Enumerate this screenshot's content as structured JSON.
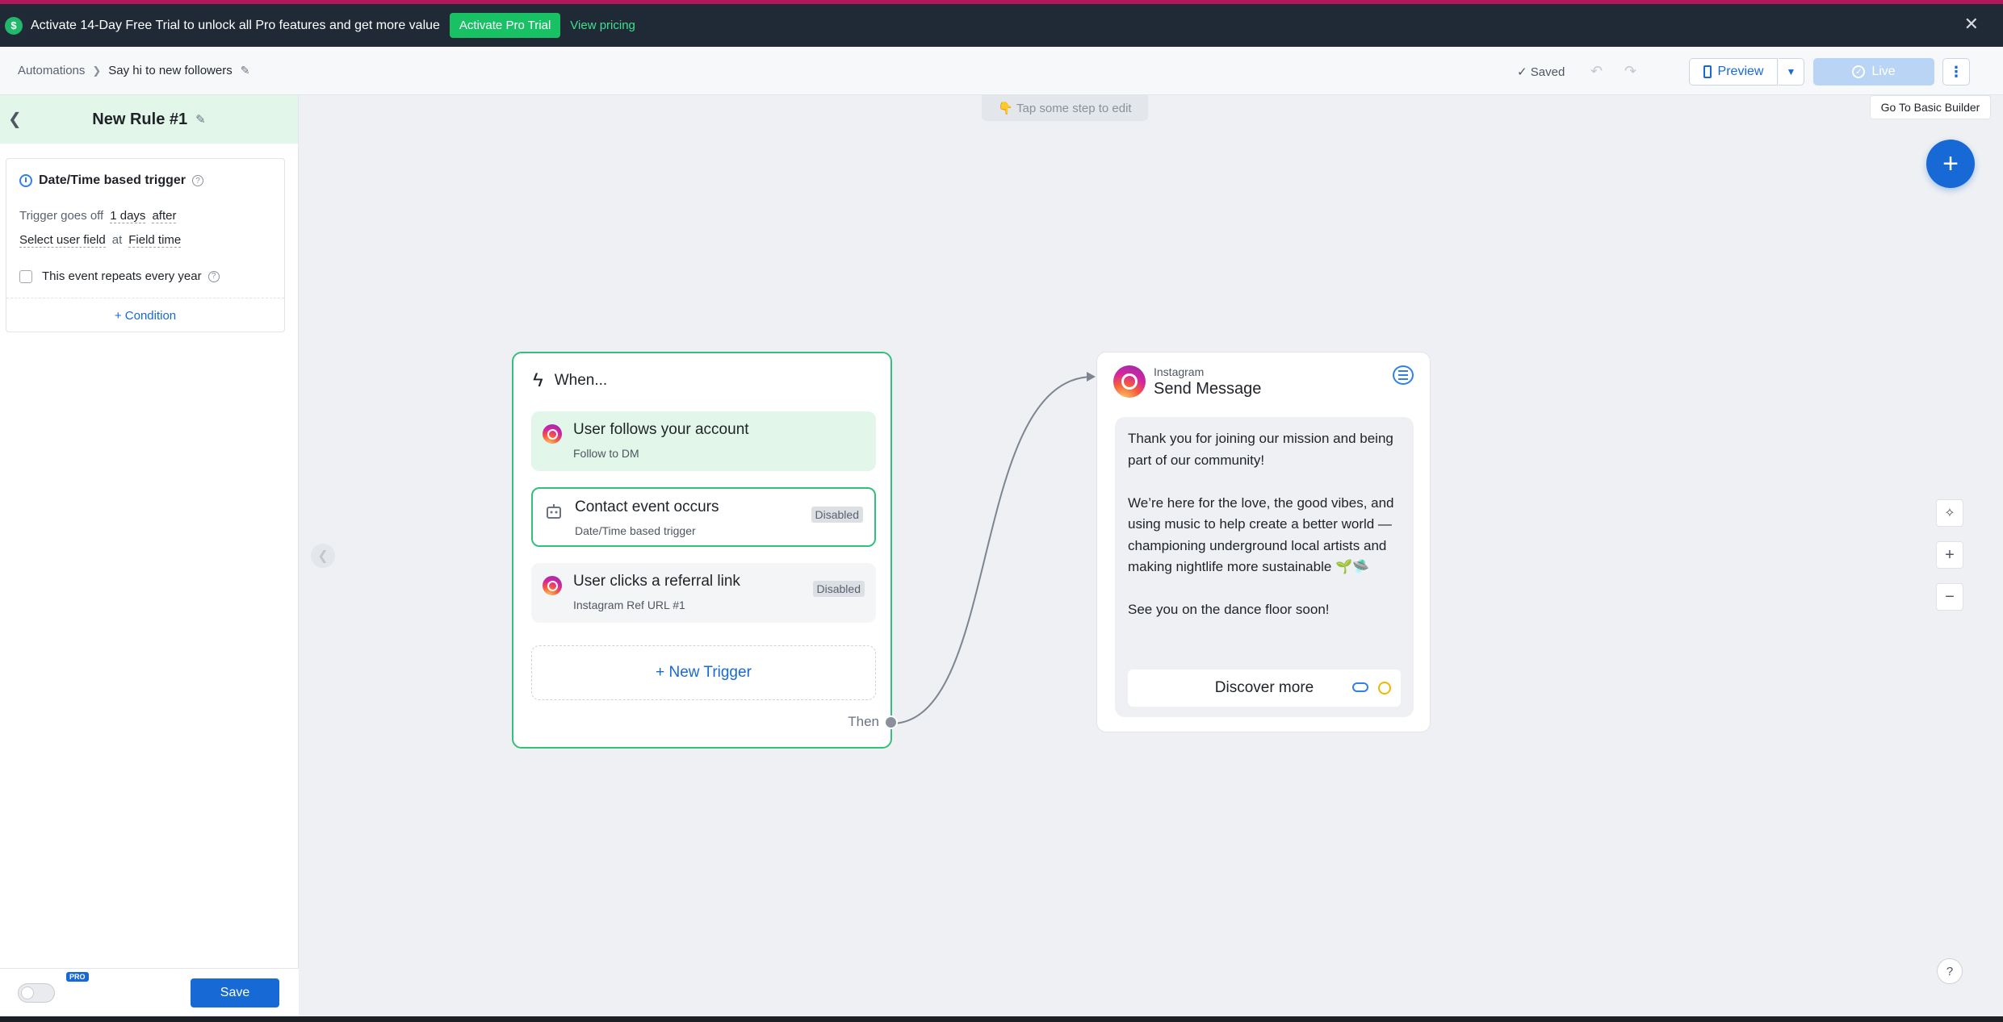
{
  "banner": {
    "icon": "$",
    "text": "Activate 14-Day Free Trial to unlock all Pro features and get more value",
    "cta_label": "Activate Pro Trial",
    "link_label": "View pricing",
    "close": "✕"
  },
  "header": {
    "breadcrumb_root": "Automations",
    "breadcrumb_current": "Say hi to new followers",
    "saved_status": "Saved",
    "preview_label": "Preview",
    "live_label": "Live"
  },
  "panel": {
    "rule_title": "New Rule #1",
    "trigger_card": {
      "title": "Date/Time based trigger",
      "row1_prefix": "Trigger goes off",
      "row1_amount": "1 days",
      "row1_direction": "after",
      "row2_field": "Select user field",
      "row2_at": "at",
      "row2_time": "Field time",
      "repeat_label": "This event repeats every year",
      "condition_label": "+ Condition"
    },
    "pro_badge": "PRO",
    "save_label": "Save"
  },
  "canvas": {
    "hint": "👇 Tap some step to edit",
    "basic_builder_label": "Go To Basic Builder",
    "when": {
      "title": "When...",
      "triggers": [
        {
          "title": "User follows your account",
          "subtitle": "Follow to DM",
          "badge": ""
        },
        {
          "title": "Contact event occurs",
          "subtitle": "Date/Time based trigger",
          "badge": "Disabled"
        },
        {
          "title": "User clicks a referral link",
          "subtitle": "Instagram Ref URL #1",
          "badge": "Disabled"
        }
      ],
      "new_trigger_label": "+ New Trigger",
      "then_label": "Then"
    },
    "message": {
      "channel": "Instagram",
      "title": "Send Message",
      "text": "Thank you for joining our mission and being part of our community!\n\nWe’re here for the love, the good vibes, and using music to help create a better world — championing underground local artists and making nightlife more sustainable 🌱🛸\n\nSee you on the dance floor soon!",
      "button_label": "Discover more"
    }
  },
  "colors": {
    "accent": "#1769d6",
    "trigger_border": "#33c07a",
    "banner_bg": "#1f2a36",
    "trial_green": "#18c264"
  }
}
